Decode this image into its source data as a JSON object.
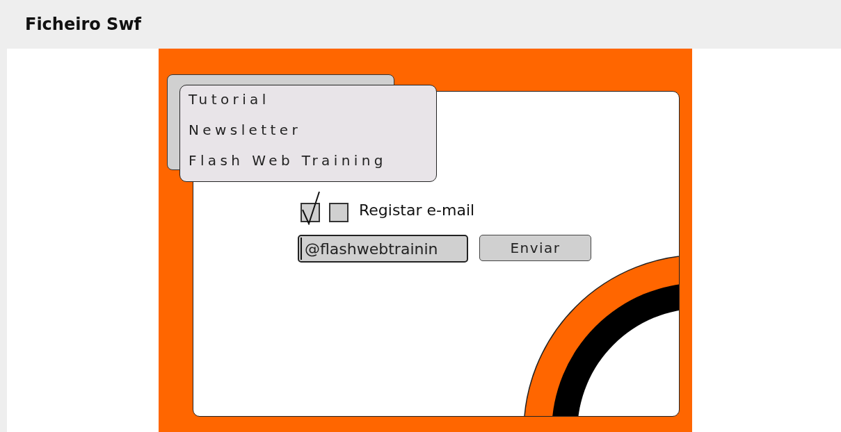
{
  "header": {
    "title": "Ficheiro Swf"
  },
  "menu": {
    "items": [
      "Tutorial",
      "Newsletter",
      "Flash Web Training"
    ]
  },
  "checkboxes": [
    {
      "checked": true
    },
    {
      "checked": false
    }
  ],
  "checkbox_label": "Registar e-mail",
  "email_field": {
    "value": "@flashwebtrainin"
  },
  "submit_button": "Enviar"
}
